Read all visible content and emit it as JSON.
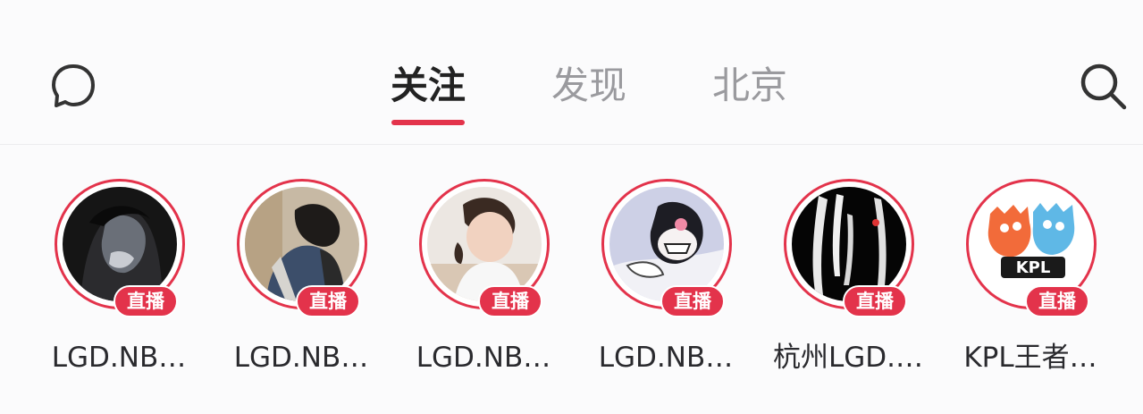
{
  "header": {
    "chat_icon": "chat-bubble-icon",
    "search_icon": "search-icon",
    "tabs": [
      {
        "label": "关注",
        "active": true
      },
      {
        "label": "发现",
        "active": false
      },
      {
        "label": "北京",
        "active": false
      }
    ],
    "accent_color": "#e3334b"
  },
  "stories": [
    {
      "name": "LGD.NB…",
      "badge": "直播"
    },
    {
      "name": "LGD.NB…",
      "badge": "直播"
    },
    {
      "name": "LGD.NB…",
      "badge": "直播"
    },
    {
      "name": "LGD.NB…",
      "badge": "直播"
    },
    {
      "name": "杭州LGD.…",
      "badge": "直播"
    },
    {
      "name": "KPL王者…",
      "badge": "直播",
      "avatar_logo_text": "KPL"
    }
  ]
}
